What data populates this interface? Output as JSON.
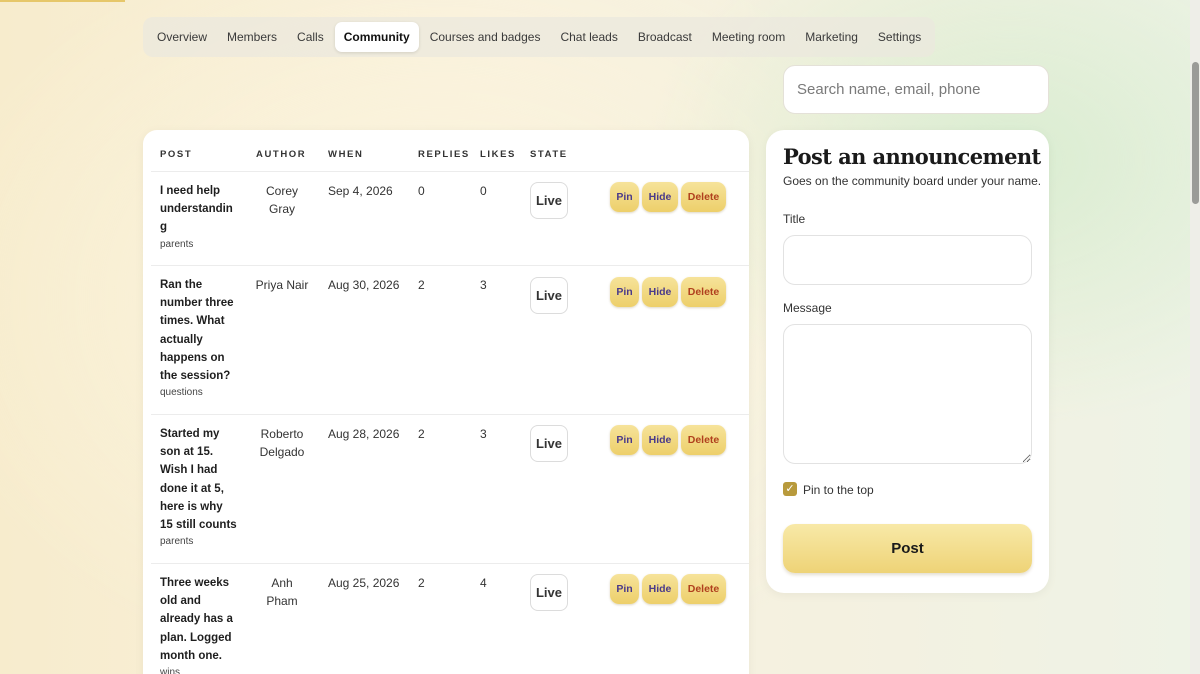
{
  "tabs": [
    {
      "label": "Overview",
      "active": false
    },
    {
      "label": "Members",
      "active": false
    },
    {
      "label": "Calls",
      "active": false
    },
    {
      "label": "Community",
      "active": true
    },
    {
      "label": "Courses and badges",
      "active": false
    },
    {
      "label": "Chat leads",
      "active": false
    },
    {
      "label": "Broadcast",
      "active": false
    },
    {
      "label": "Meeting room",
      "active": false
    },
    {
      "label": "Marketing",
      "active": false
    },
    {
      "label": "Settings",
      "active": false
    }
  ],
  "search": {
    "placeholder": "Search name, email, phone"
  },
  "table": {
    "headers": {
      "post": "POST",
      "author": "AUTHOR",
      "when": "WHEN",
      "replies": "REPLIES",
      "likes": "LIKES",
      "state": "STATE"
    },
    "rows": [
      {
        "title": "I need help understandin g",
        "tag": "parents",
        "author": "Corey Gray",
        "when": "Sep 4, 2026",
        "replies": "0",
        "likes": "0",
        "state": "Live"
      },
      {
        "title": "Ran the number three times. What actually happens on the session?",
        "tag": "questions",
        "author": "Priya Nair",
        "when": "Aug 30, 2026",
        "replies": "2",
        "likes": "3",
        "state": "Live"
      },
      {
        "title": "Started my son at 15. Wish I had done it at 5, here is why 15 still counts",
        "tag": "parents",
        "author": "Roberto Delgado",
        "when": "Aug 28, 2026",
        "replies": "2",
        "likes": "3",
        "state": "Live"
      },
      {
        "title": "Three weeks old and already has a plan. Logged month one.",
        "tag": "wins",
        "author": "Anh Pham",
        "when": "Aug 25, 2026",
        "replies": "2",
        "likes": "4",
        "state": "Live"
      }
    ],
    "actions": {
      "pin": "Pin",
      "hide": "Hide",
      "delete": "Delete"
    }
  },
  "announcement": {
    "title": "Post an announcement",
    "subtitle": "Goes on the community board under your name.",
    "title_label": "Title",
    "message_label": "Message",
    "pin_label": "Pin to the top",
    "pin_checked": true,
    "submit_label": "Post"
  },
  "colors": {
    "accent": "#edcf6a",
    "delete_text": "#b0401e",
    "pin_text": "#4a3a8a"
  }
}
